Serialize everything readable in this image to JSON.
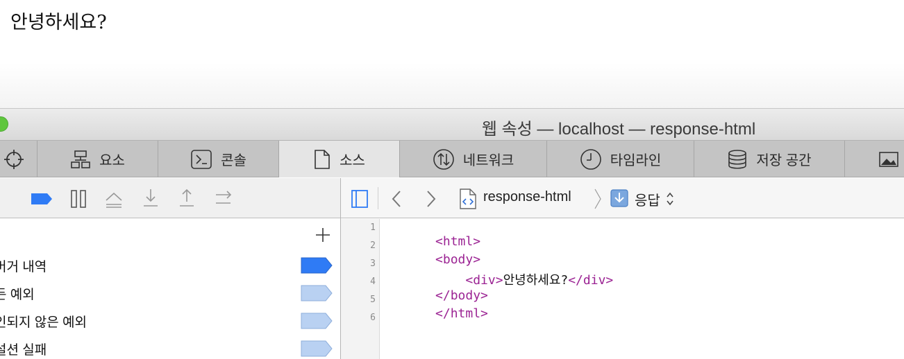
{
  "page": {
    "body_text": "안녕하세요?"
  },
  "window": {
    "title": "웹 속성 — localhost — response-html"
  },
  "tabs": [
    {
      "label": "요소",
      "icon": "elements-icon"
    },
    {
      "label": "콘솔",
      "icon": "console-icon"
    },
    {
      "label": "소스",
      "icon": "sources-icon",
      "active": true
    },
    {
      "label": "네트워크",
      "icon": "network-icon"
    },
    {
      "label": "타임라인",
      "icon": "timeline-icon"
    },
    {
      "label": "저장 공간",
      "icon": "storage-icon"
    }
  ],
  "breadcrumb": {
    "file_name": "response-html",
    "type_label": "응답"
  },
  "breakpoints": [
    {
      "label": "버거 내역",
      "enabled": true
    },
    {
      "label": "든 예외",
      "enabled": false
    },
    {
      "label": "인되지 않은 예외",
      "enabled": false
    },
    {
      "label": "설션 실패",
      "enabled": false
    }
  ],
  "editor": {
    "line_numbers": [
      "1",
      "2",
      "3",
      "4",
      "5",
      "6"
    ],
    "lines": [
      {
        "open": "<html>",
        "text": "",
        "close": ""
      },
      {
        "open": "<body>",
        "text": "",
        "close": ""
      },
      {
        "open": "    <div>",
        "text": "안녕하세요?",
        "close": "</div>"
      },
      {
        "open": "</body>",
        "text": "",
        "close": ""
      },
      {
        "open": "</html>",
        "text": "",
        "close": ""
      }
    ]
  },
  "colors": {
    "tag": "#9b2393",
    "breakpoint_active": "#2f7bf5",
    "breakpoint_inactive": "#b9d1f2",
    "active_tab": "#e5e5e5"
  }
}
